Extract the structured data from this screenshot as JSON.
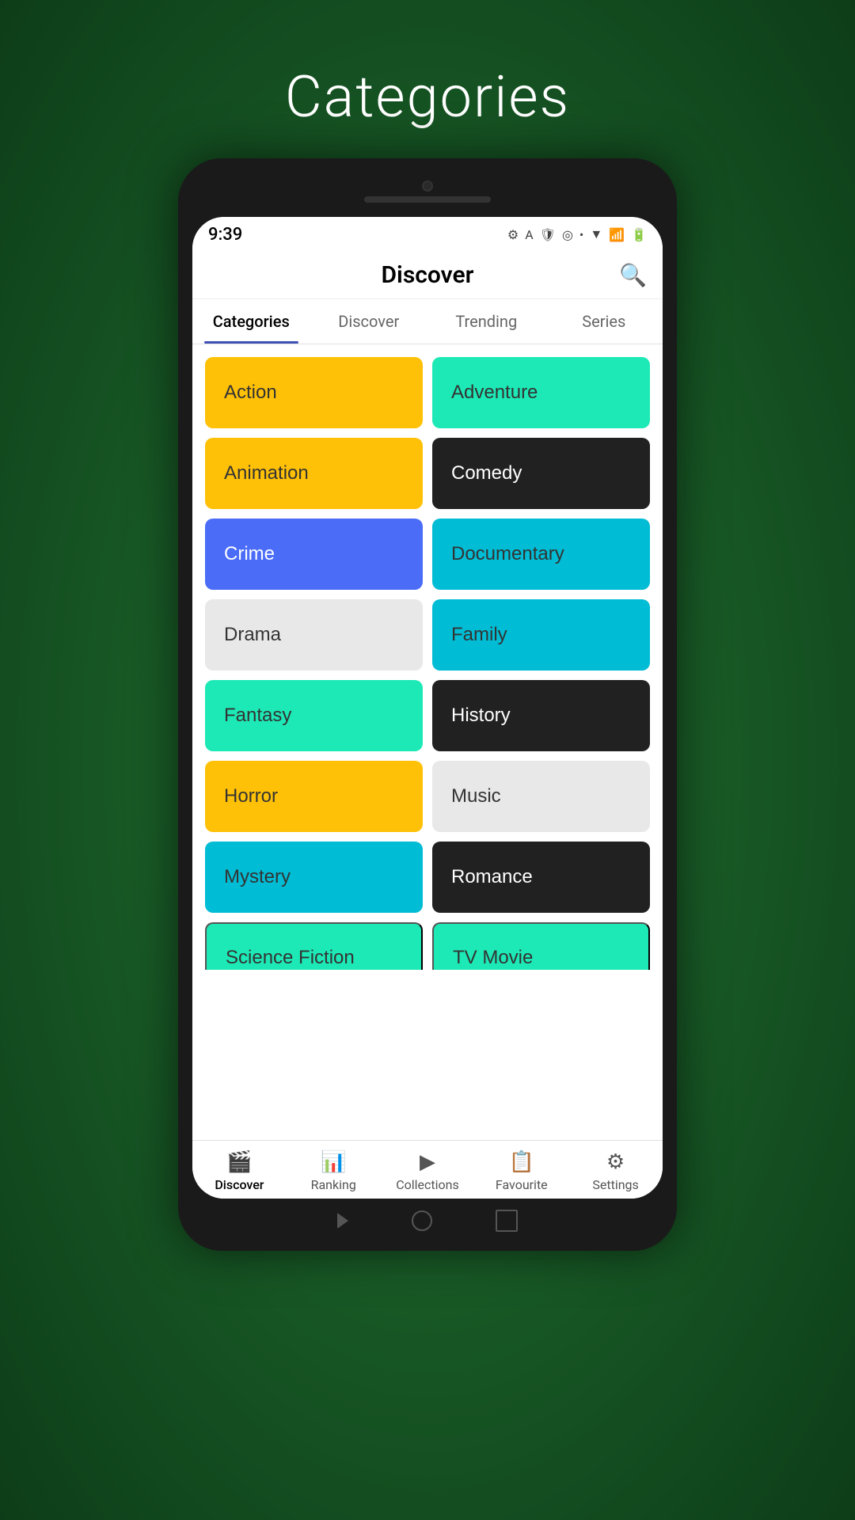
{
  "page": {
    "title": "Categories",
    "background_color": "#1a5e28"
  },
  "status_bar": {
    "time": "9:39",
    "icons": [
      "⚙",
      "A",
      "🛡",
      "◎",
      "•"
    ]
  },
  "top_bar": {
    "title": "Discover",
    "search_icon": "🔍"
  },
  "tabs": [
    {
      "label": "Categories",
      "active": true
    },
    {
      "label": "Discover",
      "active": false
    },
    {
      "label": "Trending",
      "active": false
    },
    {
      "label": "Series",
      "active": false
    }
  ],
  "categories": [
    {
      "left": {
        "label": "Action",
        "color_class": "cat-yellow"
      },
      "right": {
        "label": "Adventure",
        "color_class": "cat-teal"
      }
    },
    {
      "left": {
        "label": "Animation",
        "color_class": "cat-yellow"
      },
      "right": {
        "label": "Comedy",
        "color_class": "cat-black"
      }
    },
    {
      "left": {
        "label": "Crime",
        "color_class": "cat-blue"
      },
      "right": {
        "label": "Documentary",
        "color_class": "cat-cyan"
      }
    },
    {
      "left": {
        "label": "Drama",
        "color_class": "cat-light"
      },
      "right": {
        "label": "Family",
        "color_class": "cat-cyan"
      }
    },
    {
      "left": {
        "label": "Fantasy",
        "color_class": "cat-teal"
      },
      "right": {
        "label": "History",
        "color_class": "cat-black"
      }
    },
    {
      "left": {
        "label": "Horror",
        "color_class": "cat-yellow"
      },
      "right": {
        "label": "Music",
        "color_class": "cat-light"
      }
    },
    {
      "left": {
        "label": "Mystery",
        "color_class": "cat-cyan"
      },
      "right": {
        "label": "Romance",
        "color_class": "cat-black"
      }
    },
    {
      "left": {
        "label": "Science Fiction",
        "color_class": "cat-teal"
      },
      "right": {
        "label": "TV Movie",
        "color_class": "cat-teal"
      }
    }
  ],
  "bottom_nav": [
    {
      "label": "Discover",
      "icon": "🎬",
      "active": true
    },
    {
      "label": "Ranking",
      "icon": "📊",
      "active": false
    },
    {
      "label": "Collections",
      "icon": "▶",
      "active": false
    },
    {
      "label": "Favourite",
      "icon": "📋",
      "active": false
    },
    {
      "label": "Settings",
      "icon": "⚙",
      "active": false
    }
  ]
}
